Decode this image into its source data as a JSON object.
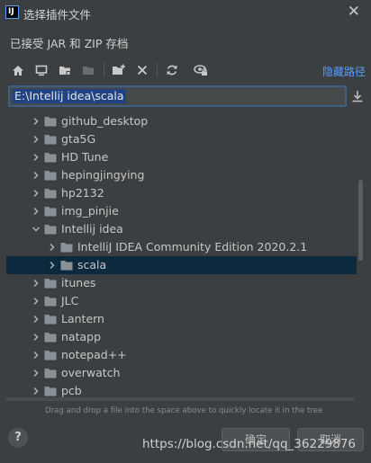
{
  "window": {
    "title": "选择插件文件",
    "app_icon_text": "IJ"
  },
  "description": "已接受 JAR 和 ZIP 存档",
  "toolbar": {
    "icons": [
      "home-icon",
      "desktop-icon",
      "project-folder-icon",
      "module-folder-icon",
      "new-folder-icon",
      "delete-icon",
      "refresh-icon",
      "show-hidden-icon"
    ],
    "hide_path_label": "隐藏路径"
  },
  "path_field": {
    "value": "E:\\Intellij idea\\scala"
  },
  "tree": {
    "items": [
      {
        "label": "github_desktop",
        "depth": 0,
        "expanded": false,
        "selected": false
      },
      {
        "label": "gta5G",
        "depth": 0,
        "expanded": false,
        "selected": false
      },
      {
        "label": "HD Tune",
        "depth": 0,
        "expanded": false,
        "selected": false
      },
      {
        "label": "hepingjingying",
        "depth": 0,
        "expanded": false,
        "selected": false
      },
      {
        "label": "hp2132",
        "depth": 0,
        "expanded": false,
        "selected": false
      },
      {
        "label": "img_pinjie",
        "depth": 0,
        "expanded": false,
        "selected": false
      },
      {
        "label": "Intellij idea",
        "depth": 0,
        "expanded": true,
        "selected": false
      },
      {
        "label": "IntelliJ IDEA Community Edition 2020.2.1",
        "depth": 1,
        "expanded": false,
        "selected": false
      },
      {
        "label": "scala",
        "depth": 1,
        "expanded": false,
        "selected": true
      },
      {
        "label": "itunes",
        "depth": 0,
        "expanded": false,
        "selected": false
      },
      {
        "label": "JLC",
        "depth": 0,
        "expanded": false,
        "selected": false
      },
      {
        "label": "Lantern",
        "depth": 0,
        "expanded": false,
        "selected": false
      },
      {
        "label": "natapp",
        "depth": 0,
        "expanded": false,
        "selected": false
      },
      {
        "label": "notepad++",
        "depth": 0,
        "expanded": false,
        "selected": false
      },
      {
        "label": "overwatch",
        "depth": 0,
        "expanded": false,
        "selected": false
      },
      {
        "label": "pcb",
        "depth": 0,
        "expanded": false,
        "selected": false
      }
    ]
  },
  "hint": "Drag and drop a file into the space above to quickly locate it in the tree",
  "buttons": {
    "help": "?",
    "ok": "确定",
    "cancel": "取消"
  },
  "watermark": "https://blog.csdn.net/qq_36229876",
  "colors": {
    "background": "#3c3f41",
    "selection": "#0d293e",
    "accent_link": "#589df6",
    "folder": "#8a9298"
  }
}
